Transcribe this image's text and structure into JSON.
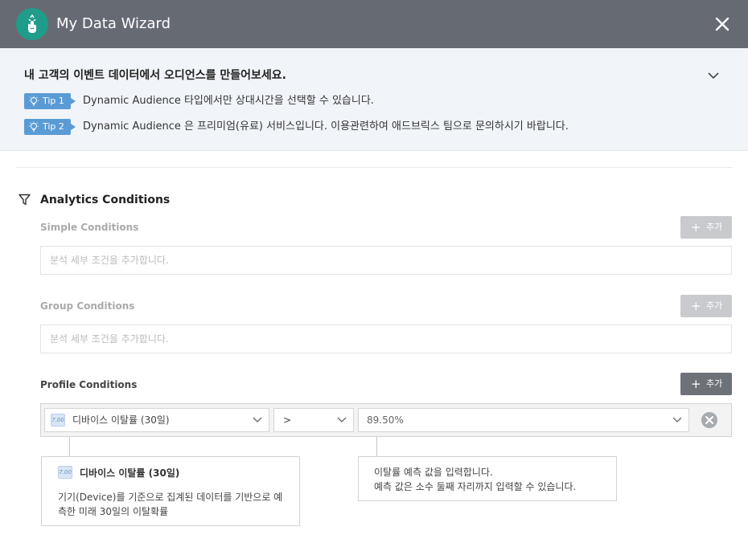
{
  "header": {
    "title": "My Data Wizard",
    "logo_icon": "hand-pointer-icon",
    "close_icon": "close-icon"
  },
  "intro": {
    "title": "내 고객의 이벤트 데이터에서 오디언스를 만들어보세요.",
    "tips": [
      {
        "label": "Tip 1",
        "text": "Dynamic Audience 타입에서만 상대시간을 선택할 수 있습니다."
      },
      {
        "label": "Tip 2",
        "text": "Dynamic Audience 은 프리미엄(유료) 서비스입니다. 이용관련하여 애드브릭스 팀으로 문의하시기 바랍니다."
      }
    ]
  },
  "analytics": {
    "title": "Analytics Conditions",
    "add_label": "추가",
    "simple": {
      "label": "Simple Conditions",
      "placeholder": "분석 세부 조건을 추가합니다."
    },
    "group": {
      "label": "Group Conditions",
      "placeholder": "분석 세부 조건을 추가합니다."
    },
    "profile": {
      "label": "Profile Conditions",
      "attribute": "디바이스 이탈률 (30일)",
      "attribute_type": "7.00",
      "operator": ">",
      "value": "89.50%"
    }
  },
  "help": {
    "attribute_title": "디바이스 이탈률 (30일)",
    "attribute_type": "7.00",
    "attribute_desc": "기기(Device)를 기준으로 집계된 데이터를 기반으로 예측한 미래 30일의 이탈확률",
    "value_line1": "이탈률 예측 값을 입력합니다.",
    "value_line2": "예측 값은 소수 둘째 자리까지 입력할 수 있습니다."
  },
  "colors": {
    "header_bg": "#666a73",
    "logo_bg": "#1f9d8a",
    "tip_badge": "#5b9bd5",
    "intro_bg": "#f1f5f9",
    "add_disabled": "#c8cacd",
    "add_active": "#6d7178"
  }
}
